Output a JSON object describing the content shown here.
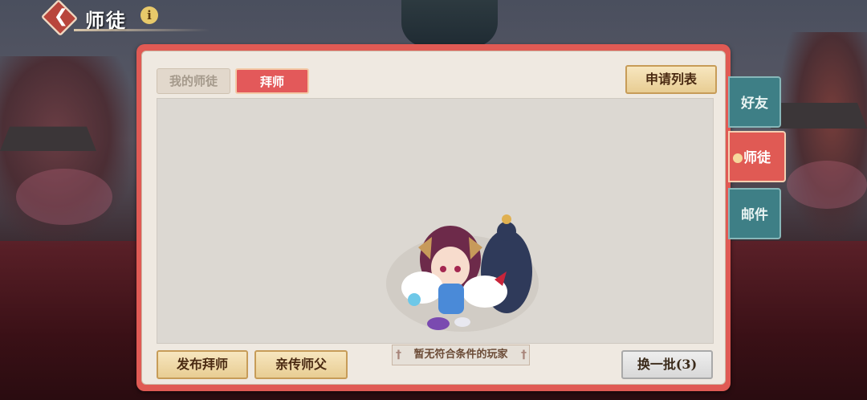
{
  "header": {
    "title": "师徒",
    "info_icon": "info-icon",
    "back_icon": "back-arrow-icon"
  },
  "tabs": [
    {
      "label": "我的师徒",
      "active": false
    },
    {
      "label": "拜师",
      "active": true
    }
  ],
  "apply_list_label": "申请列表",
  "empty_message": "暂无符合条件的玩家",
  "bottom_buttons": {
    "publish_label": "发布拜师",
    "master_label": "亲传师父",
    "refresh_label": "换一批(3)"
  },
  "side_tabs": [
    {
      "label": "好友",
      "active": false
    },
    {
      "label": "师徒",
      "active": true
    },
    {
      "label": "邮件",
      "active": false
    }
  ],
  "colors": {
    "accent": "#e05a54",
    "gold": "#e8cd93",
    "teal": "#3e7f86"
  }
}
